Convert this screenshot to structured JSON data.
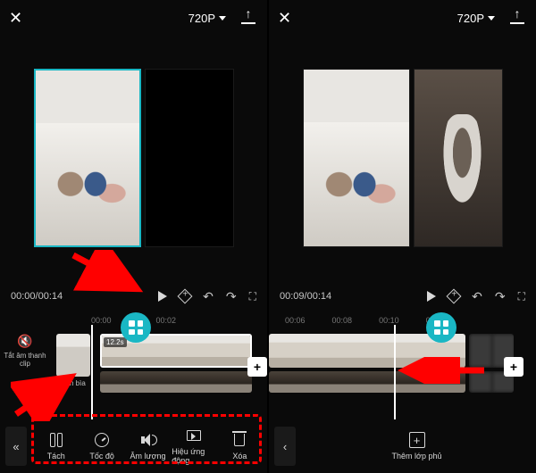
{
  "topbar": {
    "resolution": "720P"
  },
  "left": {
    "time_current": "00:00",
    "time_total": "00:14",
    "time_display": "00:00/00:14",
    "ruler": [
      "00:00",
      "00:02"
    ],
    "mute_label": "Tắt âm thanh clip",
    "cover_label": "Ảnh bìa",
    "clip_duration": "12.2s",
    "tools": {
      "split": "Tách",
      "speed": "Tốc độ",
      "volume": "Âm lượng",
      "effect": "Hiệu ứng động",
      "delete": "Xóa"
    }
  },
  "right": {
    "time_current": "00:09",
    "time_total": "00:14",
    "time_display": "00:09/00:14",
    "ruler": [
      "00:06",
      "00:08",
      "00:10",
      "00:12"
    ],
    "overlay_label": "Thêm lớp phủ"
  },
  "colors": {
    "accent": "#1ab7c4",
    "arrow": "#ff0000"
  }
}
